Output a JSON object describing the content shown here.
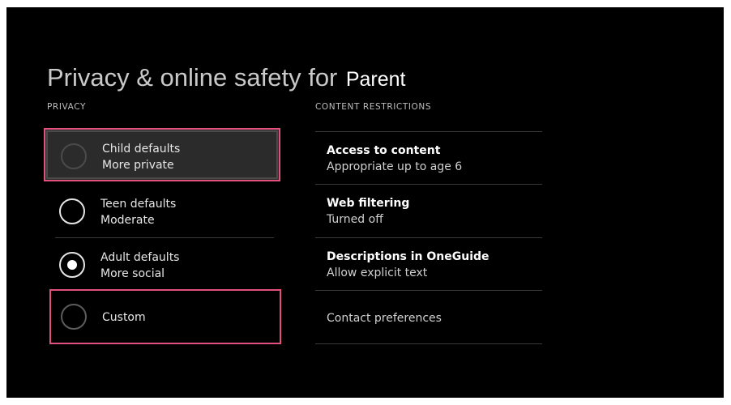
{
  "header": {
    "title": "Privacy & online safety for",
    "user": "Parent"
  },
  "privacy": {
    "label": "PRIVACY",
    "options": [
      {
        "name": "Child defaults",
        "sub": "More private",
        "selected": false,
        "focused": true
      },
      {
        "name": "Teen defaults",
        "sub": "Moderate",
        "selected": false
      },
      {
        "name": "Adult defaults",
        "sub": "More social",
        "selected": true
      },
      {
        "name": "Custom",
        "sub": "",
        "selected": false,
        "highlighted": true
      }
    ]
  },
  "content": {
    "label": "CONTENT RESTRICTIONS",
    "items": [
      {
        "title": "Access to content",
        "value": "Appropriate up to age 6"
      },
      {
        "title": "Web filtering",
        "value": "Turned off"
      },
      {
        "title": "Descriptions in OneGuide",
        "value": "Allow explicit text"
      },
      {
        "title": "Contact preferences",
        "value": ""
      }
    ]
  },
  "colors": {
    "background": "#000000",
    "focus_border": "#e2507e",
    "text": "#ffffff"
  }
}
